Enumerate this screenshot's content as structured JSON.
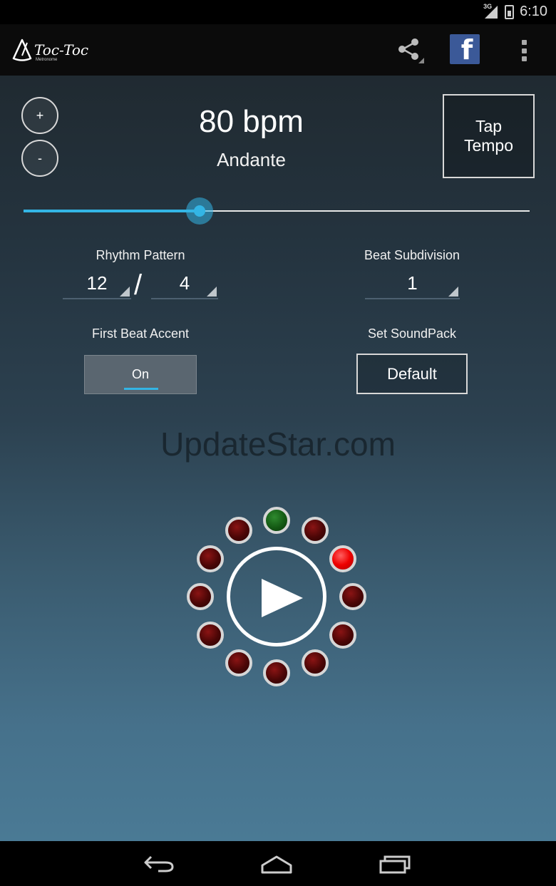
{
  "status_bar": {
    "network": "3G",
    "time": "6:10"
  },
  "app": {
    "logo_text": "Toc-Toc",
    "logo_subtext": "Metronome"
  },
  "toolbar": {
    "share_icon": "share-icon",
    "facebook_icon": "facebook-icon",
    "facebook_letter": "f",
    "overflow_icon": "overflow-icon"
  },
  "tempo": {
    "increase_label": "+",
    "decrease_label": "-",
    "bpm_text": "80 bpm",
    "tempo_name": "Andante",
    "tap_line1": "Tap",
    "tap_line2": "Tempo",
    "slider_fraction": 0.348,
    "accent_color": "#33b5e5"
  },
  "rhythm": {
    "label": "Rhythm Pattern",
    "beats": "12",
    "separator": "/",
    "note_value": "4"
  },
  "subdivision": {
    "label": "Beat Subdivision",
    "value": "1"
  },
  "accent": {
    "label": "First Beat Accent",
    "state": "On"
  },
  "soundpack": {
    "label": "Set SoundPack",
    "value": "Default"
  },
  "watermark": "UpdateStar.com",
  "beat_ring": {
    "count": 12,
    "accent_index": 0,
    "active_index": 2,
    "colors": {
      "off": "#5a0808",
      "active": "#ff0000",
      "accent": "#1e6e1e"
    }
  },
  "navigation": {
    "back_icon": "back-icon",
    "home_icon": "home-icon",
    "recents_icon": "recents-icon"
  }
}
